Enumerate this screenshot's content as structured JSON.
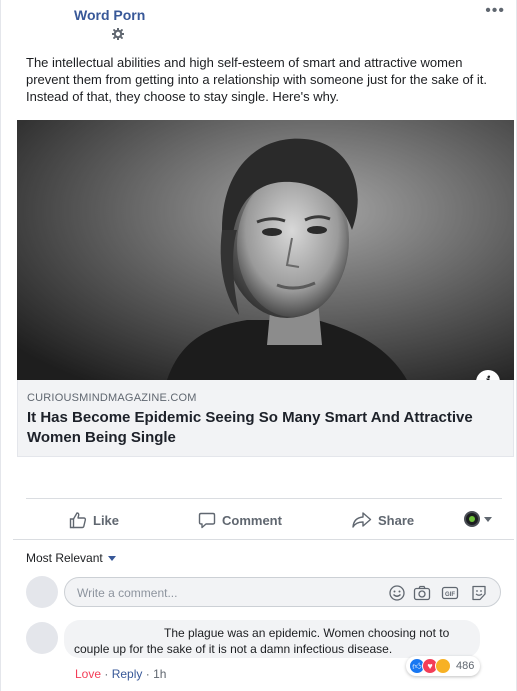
{
  "post": {
    "page_name": "Word Porn",
    "text": "The intellectual abilities and high self-esteem of smart and attractive women prevent them from getting into a relationship with someone just for the sake of it. Instead of that, they choose to stay single. Here's why.",
    "more_label": "•••"
  },
  "link": {
    "domain": "CURIOUSMINDMAGAZINE.COM",
    "title": "It Has Become Epidemic Seeing So Many Smart And Attractive Women Being Single",
    "info_label": "i"
  },
  "actions": {
    "like": "Like",
    "comment": "Comment",
    "share": "Share"
  },
  "comments": {
    "sort_label": "Most Relevant",
    "input_placeholder": "Write a comment...",
    "items": [
      {
        "text": "The plague was an epidemic. Women choosing not to couple up for the sake of it is not a damn infectious disease.",
        "reaction_count": "486",
        "actions": {
          "love": "Love",
          "separator": "·",
          "reply": "Reply",
          "time": "1h"
        }
      }
    ]
  },
  "icons": {
    "gear": "gear-icon",
    "info": "info-icon",
    "like": "thumbs-up-icon",
    "comment": "comment-bubble-icon",
    "share": "share-arrow-icon",
    "audience": "globe-icon",
    "emoji": "smiley-icon",
    "camera": "camera-icon",
    "gif": "gif-icon",
    "sticker": "sticker-icon"
  },
  "colors": {
    "link_blue": "#385898",
    "muted_gray": "#606770",
    "love_red": "#f33e58",
    "like_blue": "#1877f2",
    "link_box_bg": "#f2f3f5"
  }
}
